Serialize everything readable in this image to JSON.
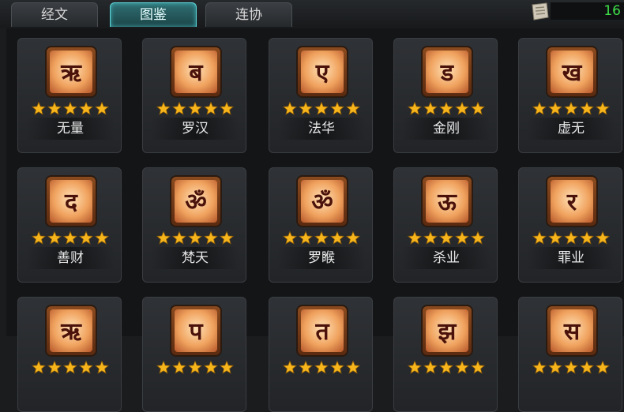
{
  "tabs": [
    {
      "label": "经文",
      "active": false
    },
    {
      "label": "图鉴",
      "active": true
    },
    {
      "label": "连协",
      "active": false
    }
  ],
  "counter": "16",
  "colors": {
    "active_tab": "#5fd5d8",
    "star": "#f7b51c",
    "counter_text": "#3ee04a"
  },
  "cards": [
    {
      "name": "无量",
      "glyph": "ऋ",
      "stars": 5
    },
    {
      "name": "罗汉",
      "glyph": "ब",
      "stars": 5
    },
    {
      "name": "法华",
      "glyph": "ए",
      "stars": 5
    },
    {
      "name": "金刚",
      "glyph": "ड",
      "stars": 5
    },
    {
      "name": "虚无",
      "glyph": "ख",
      "stars": 5
    },
    {
      "name": "善财",
      "glyph": "द",
      "stars": 5
    },
    {
      "name": "梵天",
      "glyph": "ॐ",
      "stars": 5
    },
    {
      "name": "罗睺",
      "glyph": "ॐ",
      "stars": 5
    },
    {
      "name": "杀业",
      "glyph": "ऊ",
      "stars": 5
    },
    {
      "name": "罪业",
      "glyph": "र",
      "stars": 5
    },
    {
      "name": "",
      "glyph": "ऋ",
      "stars": 5
    },
    {
      "name": "",
      "glyph": "प",
      "stars": 5
    },
    {
      "name": "",
      "glyph": "त",
      "stars": 5
    },
    {
      "name": "",
      "glyph": "झ",
      "stars": 5
    },
    {
      "name": "",
      "glyph": "स",
      "stars": 5
    }
  ]
}
